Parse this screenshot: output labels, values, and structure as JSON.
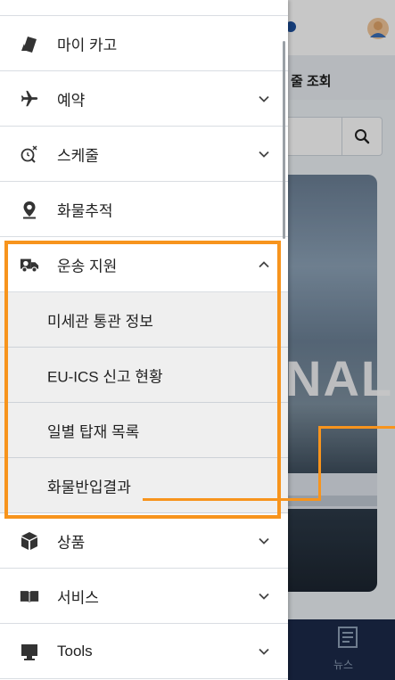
{
  "background": {
    "subtitle_fragment": "줄 조회",
    "banner_text_fragment": "NAL",
    "bottom_nav_label": "뉴스"
  },
  "drawer": {
    "items": [
      {
        "label": "마이 카고",
        "icon": "card-icon",
        "chevron": "none"
      },
      {
        "label": "예약",
        "icon": "airplane-icon",
        "chevron": "down"
      },
      {
        "label": "스케줄",
        "icon": "schedule-search-icon",
        "chevron": "down"
      },
      {
        "label": "화물추적",
        "icon": "location-pin-icon",
        "chevron": "none"
      },
      {
        "label": "운송 지원",
        "icon": "truck-icon",
        "chevron": "up"
      }
    ],
    "sub_items": [
      {
        "label": "미세관 통관 정보"
      },
      {
        "label": "EU-ICS 신고 현황"
      },
      {
        "label": "일별 탑재 목록"
      },
      {
        "label": "화물반입결과"
      }
    ],
    "items_after": [
      {
        "label": "상품",
        "icon": "box-icon",
        "chevron": "down"
      },
      {
        "label": "서비스",
        "icon": "book-icon",
        "chevron": "down"
      },
      {
        "label": "Tools",
        "icon": "monitor-icon",
        "chevron": "down"
      }
    ]
  },
  "colors": {
    "highlight": "#f7941d",
    "submenu_bg": "#efefef",
    "icon": "#333333",
    "nav_bg": "#1b2a4a"
  }
}
